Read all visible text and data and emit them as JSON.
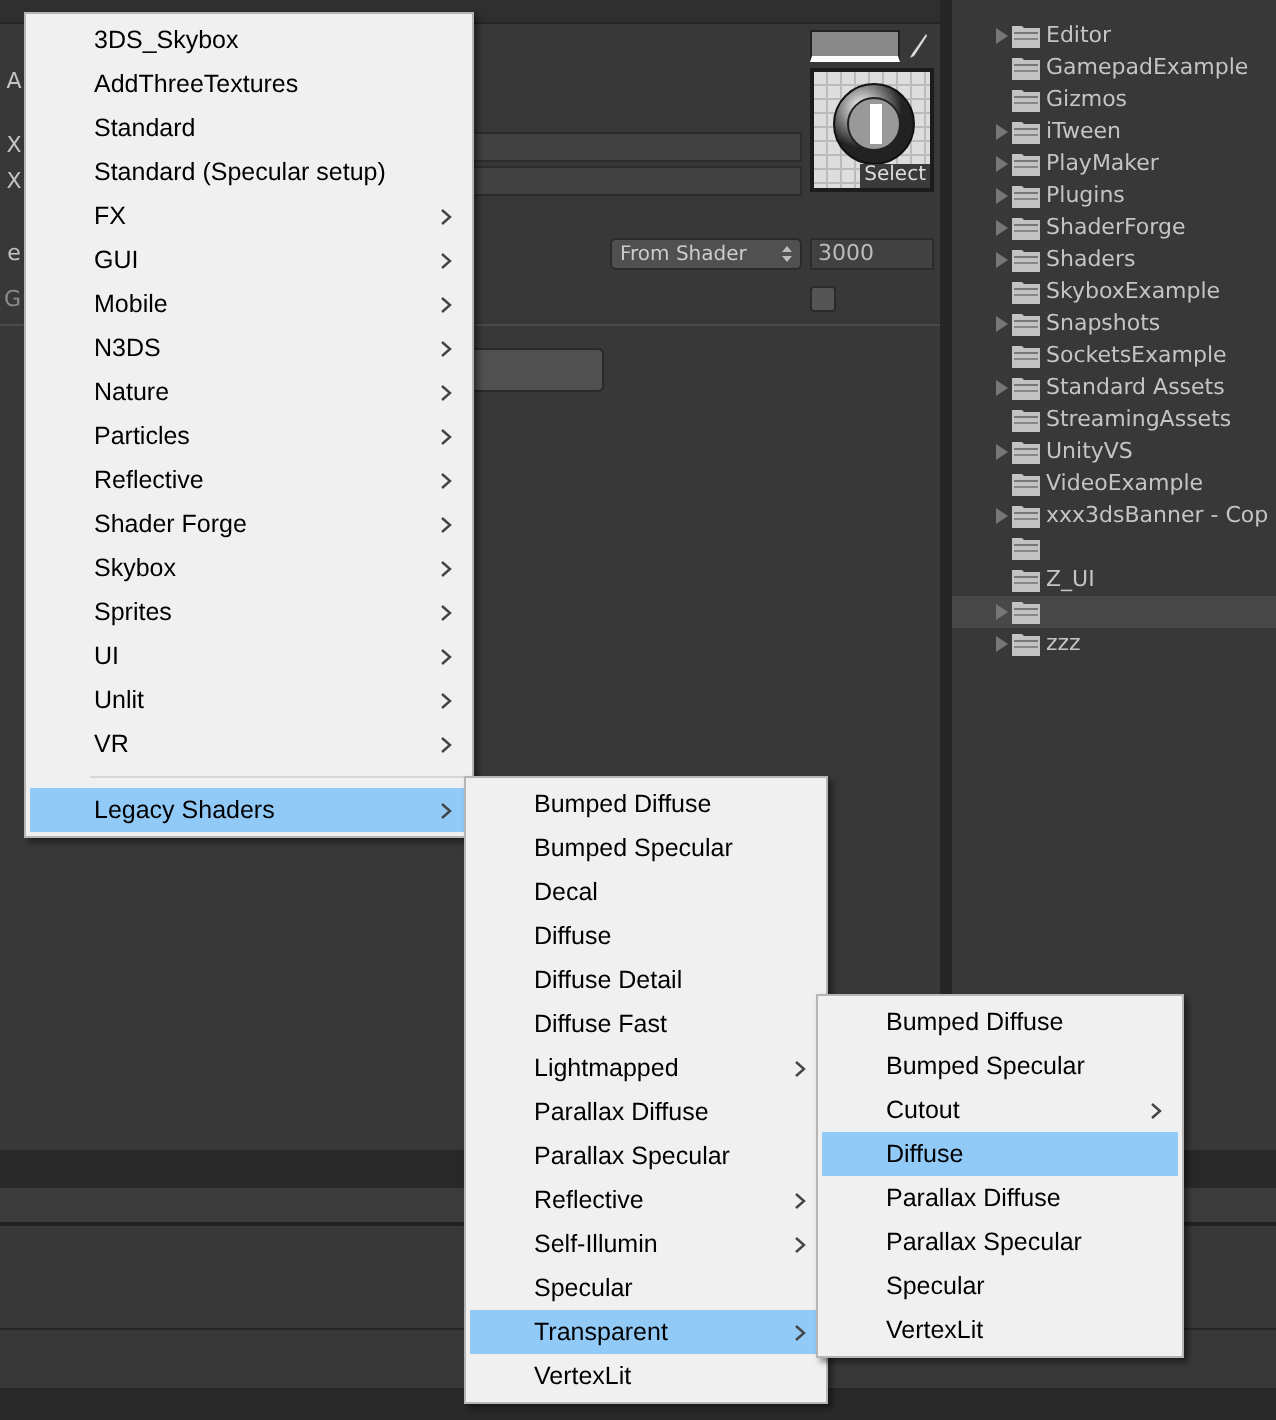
{
  "inspector": {
    "property_labels": [
      "A",
      "X",
      "X"
    ],
    "texture_button": "Select",
    "queue_label": "e",
    "queue_dropdown": "From Shader",
    "queue_value": "3000",
    "gi_label": "G",
    "gi_checkbox": {
      "checked": false
    }
  },
  "project_tree": [
    {
      "name": "Editor",
      "has_children": true,
      "selected": false
    },
    {
      "name": "GamepadExample",
      "has_children": false,
      "selected": false
    },
    {
      "name": "Gizmos",
      "has_children": false,
      "selected": false
    },
    {
      "name": "iTween",
      "has_children": true,
      "selected": false
    },
    {
      "name": "PlayMaker",
      "has_children": true,
      "selected": false
    },
    {
      "name": "Plugins",
      "has_children": true,
      "selected": false
    },
    {
      "name": "ShaderForge",
      "has_children": true,
      "selected": false
    },
    {
      "name": "Shaders",
      "has_children": true,
      "selected": false
    },
    {
      "name": "SkyboxExample",
      "has_children": false,
      "selected": false
    },
    {
      "name": "Snapshots",
      "has_children": true,
      "selected": false
    },
    {
      "name": "SocketsExample",
      "has_children": false,
      "selected": false
    },
    {
      "name": "Standard Assets",
      "has_children": true,
      "selected": false
    },
    {
      "name": "StreamingAssets",
      "has_children": false,
      "selected": false
    },
    {
      "name": "UnityVS",
      "has_children": true,
      "selected": false
    },
    {
      "name": "VideoExample",
      "has_children": false,
      "selected": false
    },
    {
      "name": "xxx3dsBanner - Cop",
      "has_children": true,
      "selected": false
    },
    {
      "has_children": false,
      "selected": false
    },
    {
      "name": "Z_UI",
      "has_children": false,
      "selected": false
    },
    {
      "has_children": true,
      "selected": true
    },
    {
      "name": "zzz",
      "has_children": true,
      "selected": false
    }
  ],
  "menus": [
    {
      "items": [
        {
          "label": "3DS_Skybox",
          "kind": "item",
          "selected": false
        },
        {
          "label": "AddThreeTextures",
          "kind": "item",
          "selected": false
        },
        {
          "label": "Standard",
          "kind": "item",
          "selected": false
        },
        {
          "label": "Standard (Specular setup)",
          "kind": "item",
          "selected": false
        },
        {
          "label": "FX",
          "kind": "submenu",
          "selected": false
        },
        {
          "label": "GUI",
          "kind": "submenu",
          "selected": false
        },
        {
          "label": "Mobile",
          "kind": "submenu",
          "selected": false
        },
        {
          "label": "N3DS",
          "kind": "submenu",
          "selected": false
        },
        {
          "label": "Nature",
          "kind": "submenu",
          "selected": false
        },
        {
          "label": "Particles",
          "kind": "submenu",
          "selected": false
        },
        {
          "label": "Reflective",
          "kind": "submenu",
          "selected": false
        },
        {
          "label": "Shader Forge",
          "kind": "submenu",
          "selected": false
        },
        {
          "label": "Skybox",
          "kind": "submenu",
          "selected": false
        },
        {
          "label": "Sprites",
          "kind": "submenu",
          "selected": false
        },
        {
          "label": "UI",
          "kind": "submenu",
          "selected": false
        },
        {
          "label": "Unlit",
          "kind": "submenu",
          "selected": false
        },
        {
          "label": "VR",
          "kind": "submenu",
          "selected": false
        },
        {
          "kind": "separator"
        },
        {
          "label": "Legacy Shaders",
          "kind": "submenu",
          "selected": true
        }
      ]
    },
    {
      "items": [
        {
          "label": "Bumped Diffuse",
          "kind": "item",
          "selected": false
        },
        {
          "label": "Bumped Specular",
          "kind": "item",
          "selected": false
        },
        {
          "label": "Decal",
          "kind": "item",
          "selected": false
        },
        {
          "label": "Diffuse",
          "kind": "item",
          "selected": false
        },
        {
          "label": "Diffuse Detail",
          "kind": "item",
          "selected": false
        },
        {
          "label": "Diffuse Fast",
          "kind": "item",
          "selected": false
        },
        {
          "label": "Lightmapped",
          "kind": "submenu",
          "selected": false
        },
        {
          "label": "Parallax Diffuse",
          "kind": "item",
          "selected": false
        },
        {
          "label": "Parallax Specular",
          "kind": "item",
          "selected": false
        },
        {
          "label": "Reflective",
          "kind": "submenu",
          "selected": false
        },
        {
          "label": "Self-Illumin",
          "kind": "submenu",
          "selected": false
        },
        {
          "label": "Specular",
          "kind": "item",
          "selected": false
        },
        {
          "label": "Transparent",
          "kind": "submenu",
          "selected": true
        },
        {
          "label": "VertexLit",
          "kind": "item",
          "selected": false
        }
      ]
    },
    {
      "items": [
        {
          "label": "Bumped Diffuse",
          "kind": "item",
          "selected": false
        },
        {
          "label": "Bumped Specular",
          "kind": "item",
          "selected": false
        },
        {
          "label": "Cutout",
          "kind": "submenu",
          "selected": false
        },
        {
          "label": "Diffuse",
          "kind": "item",
          "selected": true
        },
        {
          "label": "Parallax Diffuse",
          "kind": "item",
          "selected": false
        },
        {
          "label": "Parallax Specular",
          "kind": "item",
          "selected": false
        },
        {
          "label": "Specular",
          "kind": "item",
          "selected": false
        },
        {
          "label": "VertexLit",
          "kind": "item",
          "selected": false
        }
      ]
    }
  ]
}
